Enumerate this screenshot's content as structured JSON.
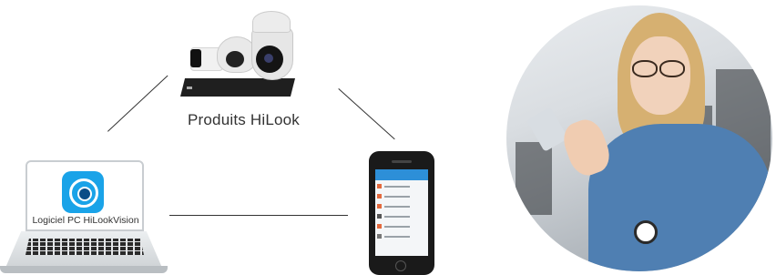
{
  "labels": {
    "products": "Produits HiLook",
    "pc_software": "Logiciel PC HiLookVision"
  },
  "icons": {
    "pc_app": "hilookvision-app-icon",
    "cameras": "security-cameras-image",
    "nvr": "nvr-recorder-image",
    "laptop": "laptop-image",
    "smartphone": "smartphone-image",
    "photo": "woman-using-smartphone-photo"
  },
  "colors": {
    "app_icon": "#1aa3e8",
    "phone_header": "#2d8fd8",
    "lines": "#333333"
  }
}
